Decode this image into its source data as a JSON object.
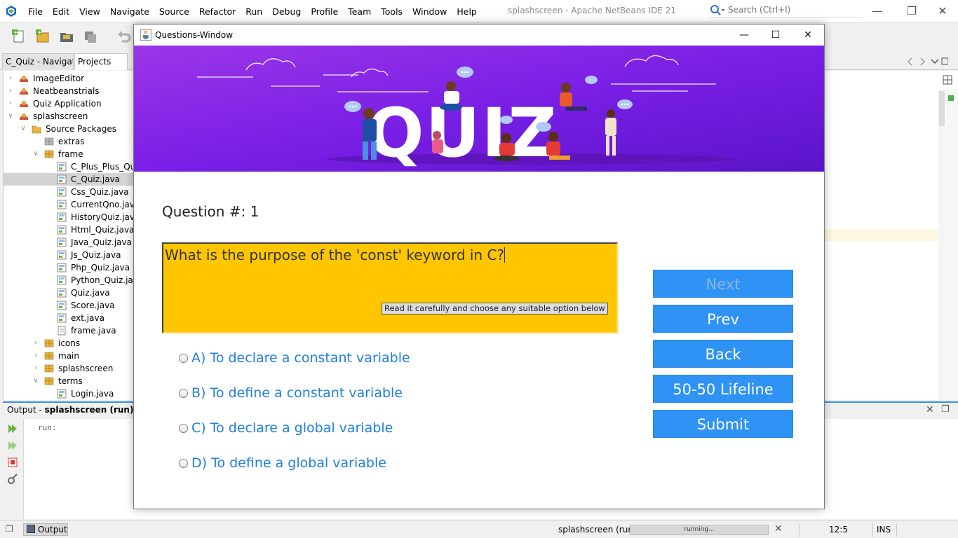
{
  "ide": {
    "menu": [
      "File",
      "Edit",
      "View",
      "Navigate",
      "Source",
      "Refactor",
      "Run",
      "Debug",
      "Profile",
      "Team",
      "Tools",
      "Window",
      "Help"
    ],
    "window_title": "splashscreen - Apache NetBeans IDE 21",
    "search_placeholder": "Search (Ctrl+I)",
    "left_tabs": [
      "C_Quiz - Navigat...",
      "Projects"
    ],
    "tree": [
      {
        "label": "ImageEditor",
        "depth": 0,
        "twisty": ">",
        "icon": "project-icon"
      },
      {
        "label": "Neatbeanstrials",
        "depth": 0,
        "twisty": ">",
        "icon": "project-icon"
      },
      {
        "label": "Quiz Application",
        "depth": 0,
        "twisty": ">",
        "icon": "project-icon"
      },
      {
        "label": "splashscreen",
        "depth": 0,
        "twisty": "v",
        "icon": "project-icon"
      },
      {
        "label": "Source Packages",
        "depth": 1,
        "twisty": "v",
        "icon": "source-folder-icon"
      },
      {
        "label": "extras",
        "depth": 2,
        "twisty": "",
        "icon": "empty-package-icon"
      },
      {
        "label": "frame",
        "depth": 2,
        "twisty": "v",
        "icon": "package-icon"
      },
      {
        "label": "C_Plus_Plus_Quiz.java",
        "depth": 3,
        "twisty": "",
        "icon": "java-form-icon"
      },
      {
        "label": "C_Quiz.java",
        "depth": 3,
        "twisty": "",
        "icon": "java-form-icon",
        "selected": true
      },
      {
        "label": "Css_Quiz.java",
        "depth": 3,
        "twisty": "",
        "icon": "java-form-icon"
      },
      {
        "label": "CurrentQno.java",
        "depth": 3,
        "twisty": "",
        "icon": "java-form-icon"
      },
      {
        "label": "HistoryQuiz.java",
        "depth": 3,
        "twisty": "",
        "icon": "java-form-icon"
      },
      {
        "label": "Html_Quiz.java",
        "depth": 3,
        "twisty": "",
        "icon": "java-form-icon"
      },
      {
        "label": "Java_Quiz.java",
        "depth": 3,
        "twisty": "",
        "icon": "java-form-icon"
      },
      {
        "label": "Js_Quiz.java",
        "depth": 3,
        "twisty": "",
        "icon": "java-form-icon"
      },
      {
        "label": "Php_Quiz.java",
        "depth": 3,
        "twisty": "",
        "icon": "java-form-icon"
      },
      {
        "label": "Python_Quiz.java",
        "depth": 3,
        "twisty": "",
        "icon": "java-form-icon"
      },
      {
        "label": "Quiz.java",
        "depth": 3,
        "twisty": "",
        "icon": "java-form-icon"
      },
      {
        "label": "Score.java",
        "depth": 3,
        "twisty": "",
        "icon": "java-form-icon"
      },
      {
        "label": "ext.java",
        "depth": 3,
        "twisty": "",
        "icon": "java-form-icon"
      },
      {
        "label": "frame.java",
        "depth": 3,
        "twisty": "",
        "icon": "java-file-icon"
      },
      {
        "label": "icons",
        "depth": 2,
        "twisty": ">",
        "icon": "package-icon"
      },
      {
        "label": "main",
        "depth": 2,
        "twisty": ">",
        "icon": "package-icon"
      },
      {
        "label": "splashscreen",
        "depth": 2,
        "twisty": ">",
        "icon": "package-icon"
      },
      {
        "label": "terms",
        "depth": 2,
        "twisty": "v",
        "icon": "package-icon"
      },
      {
        "label": "Login.java",
        "depth": 3,
        "twisty": "",
        "icon": "java-form-icon"
      }
    ],
    "output": {
      "title_prefix": "Output - ",
      "title_project": "splashscreen (run)",
      "text": "run:"
    },
    "status": {
      "output_tab": "Output",
      "task": "splashscreen (run)",
      "progress_label": "running...",
      "position": "12:5",
      "mode": "INS"
    }
  },
  "dialog": {
    "title": "Questions-Window",
    "banner_word": "QUIZ",
    "question_number_label": "Question #: ",
    "question_number": "1",
    "question_text": "What is the purpose of the 'const' keyword in C?",
    "hint": "Read it carefully and choose any suitable option below",
    "options": [
      "A) To declare a constant variable",
      "B) To define a constant variable",
      "C) To declare a global variable",
      "D) To define a global variable"
    ],
    "buttons": {
      "next": "Next",
      "prev": "Prev",
      "back": "Back",
      "lifeline": "50-50 Lifeline",
      "submit": "Submit"
    },
    "colors": {
      "banner_purple": "#7a1fe6",
      "question_box": "#ffc600",
      "button_blue": "#2e93f5",
      "option_text": "#1f7fe0"
    }
  }
}
